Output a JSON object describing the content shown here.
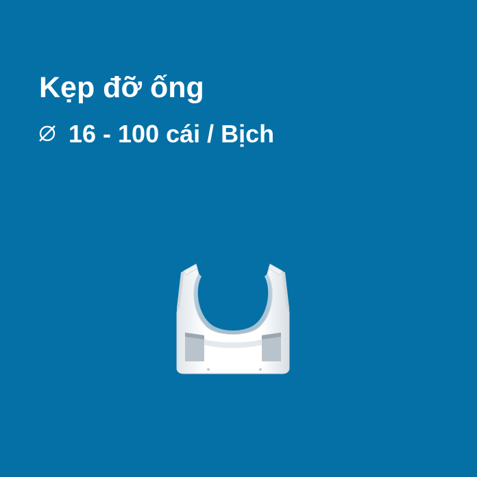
{
  "product": {
    "name": "Kẹp đỡ ống",
    "spec": "16 - 100 cái / Bịch",
    "spec_icon": "diameter-icon",
    "image": "white-pipe-clip"
  },
  "colors": {
    "background": "#0570a6",
    "text": "#ffffff"
  }
}
